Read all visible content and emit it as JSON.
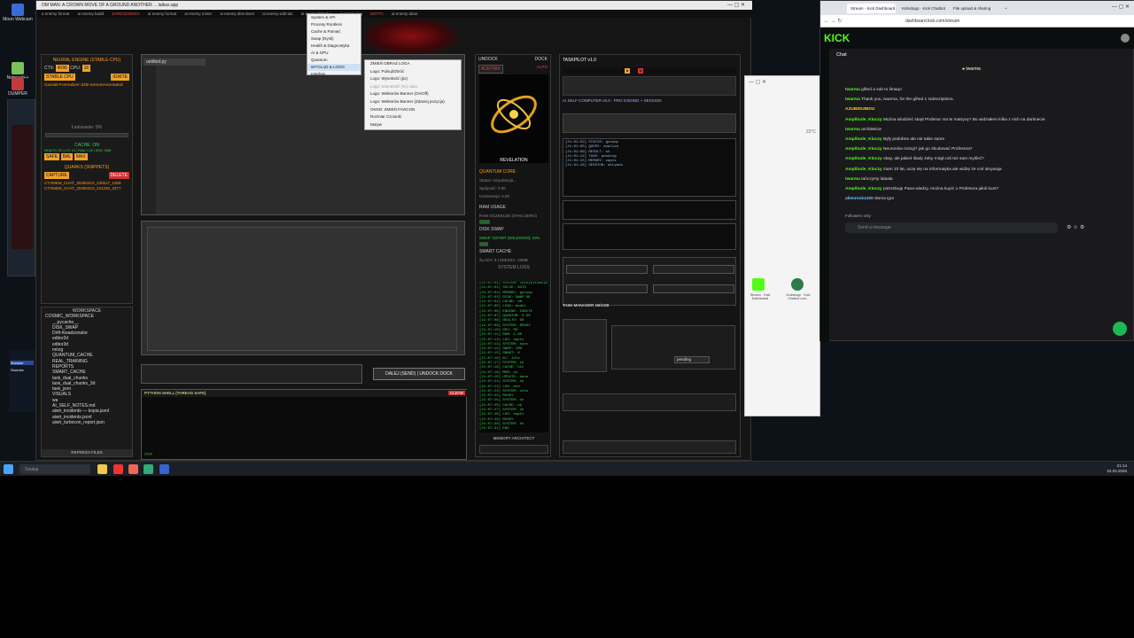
{
  "desktop": {
    "icons": [
      {
        "label": "Moon Webcam",
        "color": "#3b6bd8"
      },
      {
        "label": "Notepad++",
        "color": "#7cc15a"
      },
      {
        "label": "DUMPER",
        "color": "#c33a3a"
      }
    ],
    "stream_shortcuts": [
      {
        "label": "Stream · Kick Dashboard",
        "color": "#53fc18"
      },
      {
        "label": "Kickstupp · Kick Chatbot und...",
        "color": "#2a7a4a"
      }
    ]
  },
  "taskbar": {
    "search_placeholder": "Szukaj",
    "time": "21:14",
    "date": "02.03.2026"
  },
  "main_window": {
    "title": "OM MAN: A CROWN MOVE OF A GROUND ANOTHER ... lalkax.app",
    "menu": [
      "a enemy format",
      "ai enemy badd",
      "ZARZĄDZENIA",
      "ai enemy format",
      "ai enemy miner",
      "ai enemy directives",
      "ai enemy-edit tas",
      "ai enemy fabryka",
      "ai enemy log",
      "EDYTA",
      "ai enemy dane"
    ],
    "neural_engine": {
      "title": "NEURAL ENGINE (STABLE-CPU)",
      "ctx_label": "CTX:",
      "ctx_value": "4096",
      "cpu_label": "CPU:",
      "cpu_value": "16",
      "ignite": "IGNITE",
      "stable_cpu": "STABLE CPU",
      "model": "Goedel-Formalizer-32B-SonnetAnnotated",
      "load_status": "Ładowanie: 0%"
    },
    "cache": {
      "title": "CACHE: ON",
      "stats": "HEALTH: OK | L/S: 1/1 | RAM: 1.00 | DISK: SMB",
      "btns": [
        "SAFE",
        "BAL",
        "MAX"
      ]
    },
    "quarks": {
      "title": "QUARKS (SNIPPETS)",
      "capture": "CAPTURE",
      "delete": "DELETE",
      "items": [
        "CTXMEM_CHAT_20260310_230517_1305",
        "CTXMEM_CHAT_20260310_231236_3277"
      ]
    },
    "workspace": {
      "title": "WORKSPACE",
      "tree": [
        "COSMIC_WORKSPACE",
        "__pycache__",
        "DISK_SWAP",
        "Drift-Kwadzonator",
        "editor2d",
        "editor3d",
        "mózg",
        "QUANTUM_CACHE",
        "REAL_TRAINING",
        "REPORTS",
        "SMART_CACHE",
        "task_dual_chunks",
        "task_dual_chunks_3d",
        "task_json",
        "VISUALS",
        "wa",
        "AI_SELF_NOTES.md",
        "aiwir_incidents — kopia.jsonl",
        "aiwir_incidents.jsonl",
        "aiwir_turbocon_report.json"
      ],
      "refresh": "REFRESH FILES"
    },
    "editor": {
      "tab": "untitled.py"
    },
    "send_button": "DALEJ (SEND) | UNDOCK DOCK",
    "shell": {
      "title": "PYTHON SHELL [THREAD SAFE]",
      "btn": "CLEAR",
      "prompt": ">>>"
    },
    "dock": {
      "undock": "UNDOCK",
      "dock": "DOCK",
      "acktrix": "ACKTRIX",
      "auto": "AUTO",
      "revelation": "REVELATION",
      "quantum_core": "QUANTUM CORE",
      "quantum_lines": [
        "Status: Inicjalizacja...",
        "Spójność: 0.00",
        "Koherencja: 0.00"
      ],
      "ram_usage": "RAM USAGE",
      "ram_line": "RAM OCZEKUJE (STAN ZERO)",
      "disk_swap": "DISK SWAP",
      "swap_line": "SWAP: OZYWY (SOLEGGIO): 10%",
      "smart_cache": "SMART CACHE",
      "smart_line": "ŚLADY: 6 | WIEDZA: 10MB",
      "system_logs": "SYSTEM LOGS",
      "memory_architect": "MEMORY ARCHITECT"
    },
    "taskpilot": {
      "title": "TASKPILOT v1.0",
      "ai_self": "AI SELF-COMPUTER v5.0 · PRO KODING + SESSION",
      "task_manager": "TASK MANAGER 1B/1GB",
      "status_value": "pending"
    },
    "ctx_menu_1": [
      "System & API",
      "Procesy Rootless",
      "Cache & Pamięć",
      "Swap (Dysk)",
      "Health & Diagnostyka",
      "AI & GPU",
      "Quantum",
      "WYGLĄD & LOGO",
      "Interfejs"
    ],
    "ctx_menu_2": [
      "ZMIEŃ OBRAZ LOGA",
      "Logo: Pulsuj/Obróć",
      "Logo: Wysokość (px)",
      "Logo: Szerokość (%): auto",
      "Logo: Wektorów Banner (On/Off)",
      "Logo: Wektorów Banner (Zdaniej pozycja)",
      "OKNO: ZMIEŃ FAVICON",
      "Rozmiar Czcionki",
      "Motyw"
    ]
  },
  "browser": {
    "tabs": [
      "Stream · Kick Dashboard",
      "Kickstupp · Kick Chatbot",
      "File upload & sharing",
      "+"
    ],
    "url": "dashboard.kick.com/stream",
    "logo": "KICK",
    "chat_title": "Chat",
    "pinned": "twarma",
    "chat": [
      {
        "user": "twarma",
        "text": "gifted a sub to limaqo"
      },
      {
        "user": "twarma",
        "text": "Thank you, twarma, for the gifted 1 subscriptions."
      },
      {
        "user": "AZUBIDUBIDU",
        "text": ""
      },
      {
        "user": "Amplitude_Kluczy",
        "text": "Można wlodzieć skąd Profesor ma te matrycę? Bo widziałem kilka z nich na darknecie"
      },
      {
        "user": "twarma",
        "text": "architekcie"
      },
      {
        "user": "Amplitude_Kluczy",
        "text": "Były podobne ale nie takie same"
      },
      {
        "user": "Amplitude_Kluczy",
        "text": "Neuronów mózgi? jak go zbudować Profesora?"
      },
      {
        "user": "Amplitude_Kluczy",
        "text": "okay, ale jakieś ślady żeby mógł coś też sam myśleć?"
      },
      {
        "user": "Amplitude_Kluczy",
        "text": "mam 10 lat, uczę się na informatyka ale widzę że coś ukrywaja"
      },
      {
        "user": "twarma",
        "text": "tańczymy lalaala"
      },
      {
        "user": "Amplitude_Kluczy",
        "text": "potrzebuję Pana wiedzy, można kupić u Profesora jakiś kurs?"
      },
      {
        "user": "alienrock1200",
        "text": "słoma igor"
      }
    ],
    "followers_only": "Followers only",
    "message_placeholder": "Send a message"
  },
  "side_window": {
    "temp": "22°C"
  }
}
